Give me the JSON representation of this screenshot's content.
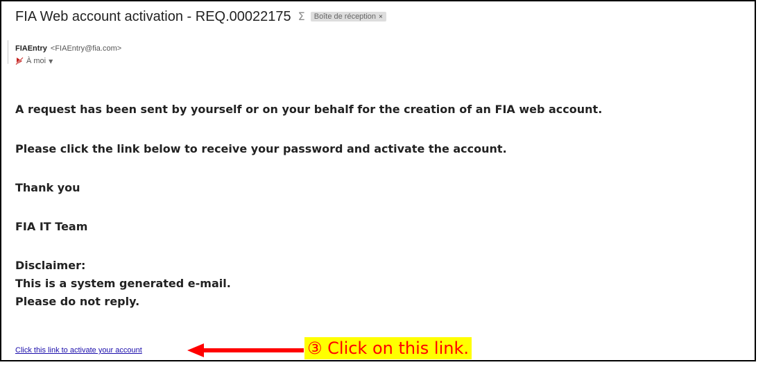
{
  "email": {
    "subject": "FIA Web account activation - REQ.00022175",
    "importance_marker": "Σ",
    "label": "Boîte de réception",
    "label_remove": "×",
    "sender_name": "FIAEntry",
    "sender_email": "<FIAEntry@fia.com>",
    "recipient": "À moi",
    "recipient_caret": "▼",
    "body": {
      "line1": "A request has been sent by yourself or on your behalf for the creation of an FIA web account.",
      "line2": "Please click the link below to receive your password and activate the account.",
      "line3": "Thank you",
      "line4": "FIA IT Team",
      "line5": "Disclaimer:",
      "line6": "This is a system generated e-mail.",
      "line7": "Please do not reply."
    },
    "link_text": "Click this link to activate your account"
  },
  "annotation": {
    "callout_text": "③ Click on this link.",
    "arrow_color": "#ff0000",
    "highlight_color": "#ffff00"
  },
  "colors": {
    "link": "#1a0dab",
    "text": "#222222",
    "frame": "#000000"
  },
  "icons": {
    "importance": "importance-marker-icon",
    "recipient_flag": "spam-flag-icon",
    "caret": "chevron-down-icon",
    "arrow": "left-arrow-icon"
  }
}
